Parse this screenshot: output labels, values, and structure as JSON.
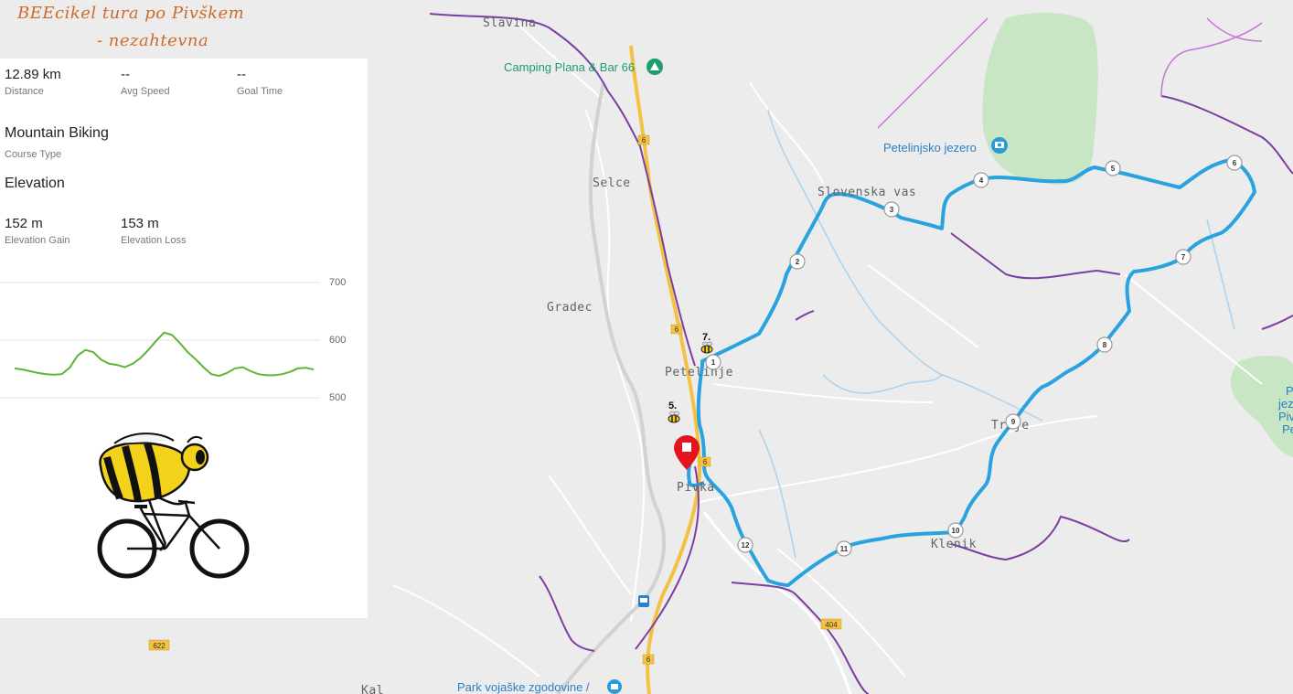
{
  "header": {
    "title_line1": "BEEcikel tura po Pivškem",
    "title_line2": "- nezahtevna"
  },
  "stats": {
    "distance": {
      "value": "12.89 km",
      "label": "Distance"
    },
    "avg_speed": {
      "value": "--",
      "label": "Avg Speed"
    },
    "goal_time": {
      "value": "--",
      "label": "Goal Time"
    },
    "course_type": {
      "value": "Mountain Biking",
      "label": "Course Type"
    },
    "elevation_heading": "Elevation",
    "elevation_gain": {
      "value": "152 m",
      "label": "Elevation Gain"
    },
    "elevation_loss": {
      "value": "153 m",
      "label": "Elevation Loss"
    }
  },
  "elevation_chart": {
    "y_ticks": [
      "700",
      "600",
      "500"
    ],
    "line_color": "#5fb336",
    "profile_m": [
      551,
      549,
      546,
      543,
      541,
      540,
      541,
      552,
      573,
      583,
      579,
      566,
      559,
      557,
      553,
      559,
      569,
      583,
      599,
      613,
      609,
      595,
      579,
      567,
      553,
      541,
      538,
      543,
      551,
      553,
      546,
      541,
      539,
      539,
      541,
      545,
      551,
      552,
      549
    ]
  },
  "map": {
    "places": {
      "slavina": "Slavina",
      "camping": "Camping Plana & Bar 66",
      "selce": "Selce",
      "petelinjsko_jezero": "Petelinjsko jezero",
      "slovenska_vas": "Slovenska vas",
      "gradec": "Gradec",
      "petelinje": "Petelinje",
      "pivka": "Pivka",
      "trnje": "Trnje",
      "klenik": "Klenik",
      "park": "Park vojaške zgodovine /",
      "kal": "Kal",
      "edge_park_1": "P",
      "edge_park_2": "jez",
      "edge_park_3": "Piv",
      "edge_park_4": "Pe"
    },
    "road_numbers": {
      "r6a": "6",
      "r6b": "6",
      "r6c": "6",
      "r6d": "6",
      "r622": "622",
      "r404": "404"
    },
    "waypoints": [
      "1",
      "2",
      "3",
      "4",
      "5",
      "6",
      "7",
      "8",
      "9",
      "10",
      "11",
      "12"
    ],
    "bee_markers": [
      "7.",
      "5."
    ],
    "route_color": "#29a3e0",
    "boundary_color": "#7b3fa3",
    "road_color": "#f3c243",
    "marker_color": "#e3141e"
  }
}
